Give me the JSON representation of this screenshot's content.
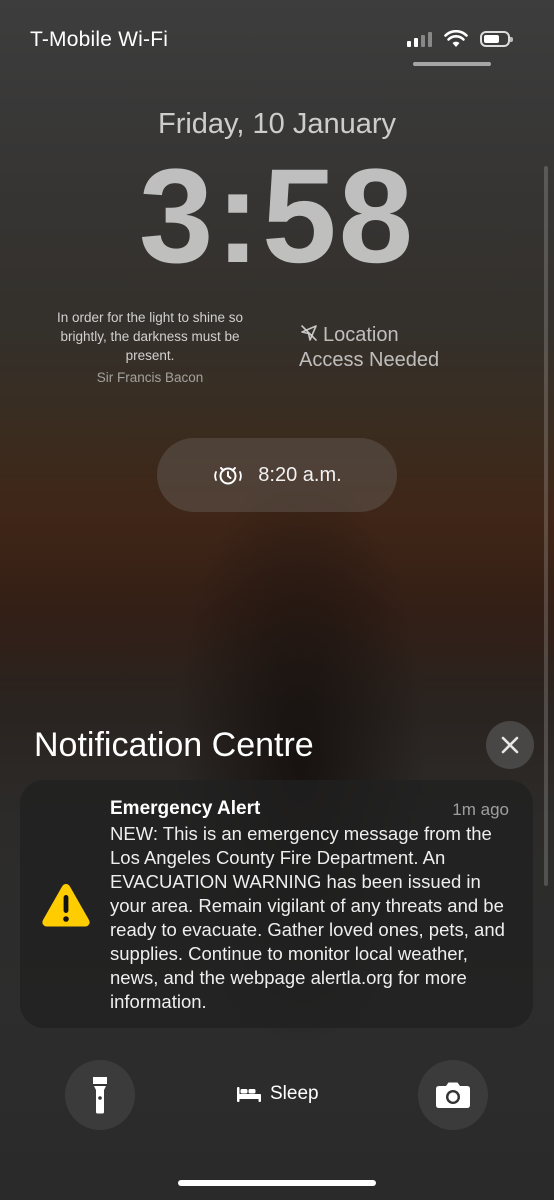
{
  "status_bar": {
    "carrier": "T-Mobile Wi-Fi"
  },
  "lock": {
    "date": "Friday, 10 January",
    "time": "3:58",
    "quote_lines": [
      "In order for the light to shine so",
      "brightly, the darkness must be",
      "present."
    ],
    "quote_author": "Sir Francis Bacon",
    "location_lines": [
      "Location",
      "Access Needed"
    ],
    "alarm_time": "8:20 a.m."
  },
  "notification_centre": {
    "title": "Notification Centre",
    "notification": {
      "title": "Emergency Alert",
      "time": "1m ago",
      "body": "NEW: This is an emergency message from the Los Angeles County Fire Department. An EVACUATION WARNING has been issued in your area. Remain vigilant of any threats and be ready to evacuate. Gather loved ones, pets, and supplies. Continue to monitor local weather, news, and the webpage alertla.org for more information.",
      "icon": "warning-icon",
      "icon_color": "#FFCC00"
    }
  },
  "bottom": {
    "sleep_label": "Sleep"
  }
}
